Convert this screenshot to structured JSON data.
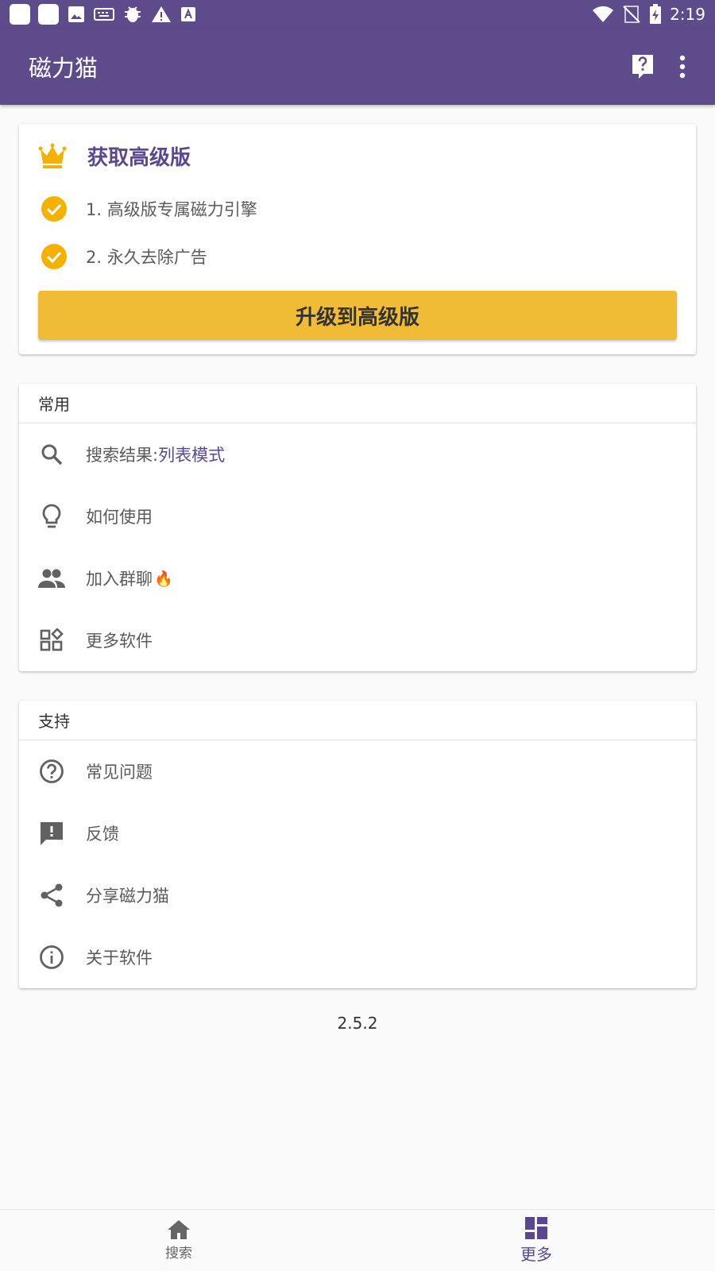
{
  "status_bar": {
    "time": "2:19"
  },
  "app_bar": {
    "title": "磁力猫"
  },
  "premium": {
    "title": "获取高级版",
    "features": [
      "1. 高级版专属磁力引擎",
      "2. 永久去除广告"
    ],
    "upgrade_label": "升级到高级版"
  },
  "common": {
    "header": "常用",
    "search_label": "搜索结果: ",
    "search_value": "列表模式",
    "howto_label": "如何使用",
    "group_label": "加入群聊",
    "group_emoji": "🔥",
    "more_apps_label": "更多软件"
  },
  "support": {
    "header": "支持",
    "faq_label": "常见问题",
    "feedback_label": "反馈",
    "share_label": "分享磁力猫",
    "about_label": "关于软件"
  },
  "version": "2.5.2",
  "bottom_nav": {
    "search_label": "搜索",
    "more_label": "更多"
  },
  "colors": {
    "primary": "#5e4b8b",
    "accent": "#f0bb35",
    "check": "#f5b100"
  }
}
